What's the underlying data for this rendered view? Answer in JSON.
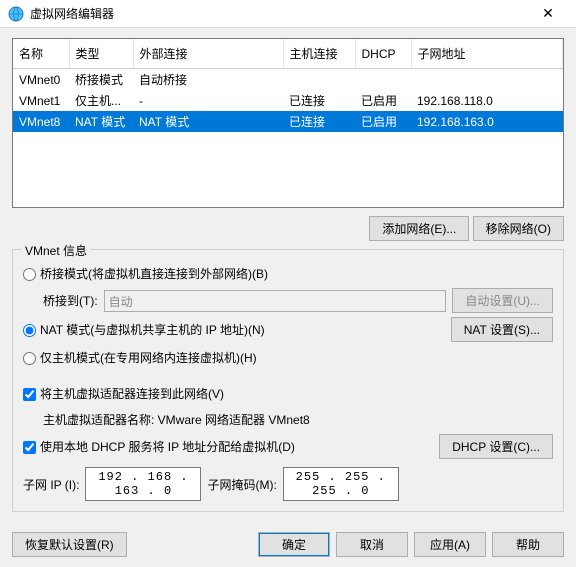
{
  "titlebar": {
    "title": "虚拟网络编辑器",
    "close": "✕"
  },
  "table": {
    "headers": [
      "名称",
      "类型",
      "外部连接",
      "主机连接",
      "DHCP",
      "子网地址"
    ],
    "rows": [
      {
        "cells": [
          "VMnet0",
          "桥接模式",
          "自动桥接",
          "",
          "",
          ""
        ],
        "selected": false
      },
      {
        "cells": [
          "VMnet1",
          "仅主机...",
          "-",
          "已连接",
          "已启用",
          "192.168.118.0"
        ],
        "selected": false
      },
      {
        "cells": [
          "VMnet8",
          "NAT 模式",
          "NAT 模式",
          "已连接",
          "已启用",
          "192.168.163.0"
        ],
        "selected": true
      }
    ]
  },
  "topButtons": {
    "add": "添加网络(E)...",
    "remove": "移除网络(O)"
  },
  "info": {
    "legend": "VMnet 信息",
    "bridge": "桥接模式(将虚拟机直接连接到外部网络)(B)",
    "bridgeToLabel": "桥接到(T):",
    "bridgeToValue": "自动",
    "autoBtn": "自动设置(U)...",
    "nat": "NAT 模式(与虚拟机共享主机的 IP 地址)(N)",
    "natBtn": "NAT 设置(S)...",
    "hostOnly": "仅主机模式(在专用网络内连接虚拟机)(H)",
    "hostAdapter": "将主机虚拟适配器连接到此网络(V)",
    "hostAdapterName": "主机虚拟适配器名称: VMware 网络适配器 VMnet8",
    "dhcp": "使用本地 DHCP 服务将 IP 地址分配给虚拟机(D)",
    "dhcpBtn": "DHCP 设置(C)...",
    "subnetIpLabel": "子网 IP (I):",
    "subnetIp": "192 . 168 . 163 .  0",
    "subnetMaskLabel": "子网掩码(M):",
    "subnetMask": "255 . 255 . 255 .  0"
  },
  "footer": {
    "restore": "恢复默认设置(R)",
    "ok": "确定",
    "cancel": "取消",
    "apply": "应用(A)",
    "help": "帮助"
  }
}
